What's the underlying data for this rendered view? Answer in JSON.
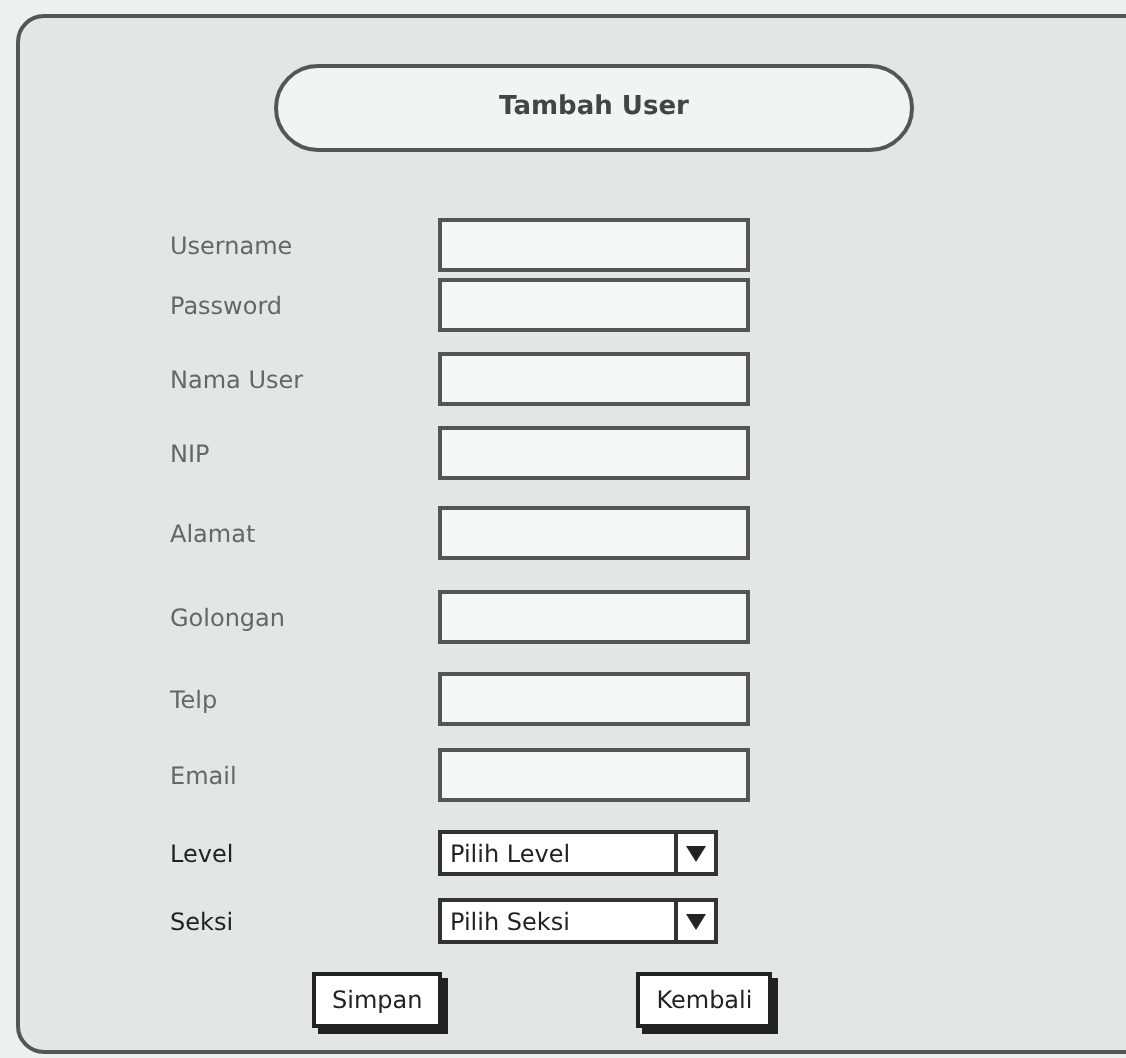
{
  "title": "Tambah User",
  "fields": [
    {
      "kind": "text",
      "label": "Username"
    },
    {
      "kind": "text",
      "label": "Password"
    },
    {
      "kind": "text",
      "label": "Nama User"
    },
    {
      "kind": "text",
      "label": "NIP"
    },
    {
      "kind": "text",
      "label": "Alamat"
    },
    {
      "kind": "text",
      "label": "Golongan"
    },
    {
      "kind": "text",
      "label": "Telp"
    },
    {
      "kind": "text",
      "label": "Email"
    },
    {
      "kind": "select",
      "label": "Level",
      "value": "Pilih Level"
    },
    {
      "kind": "select",
      "label": "Seksi",
      "value": "Pilih Seksi"
    }
  ],
  "buttons": [
    "Simpan",
    "Kembali"
  ]
}
